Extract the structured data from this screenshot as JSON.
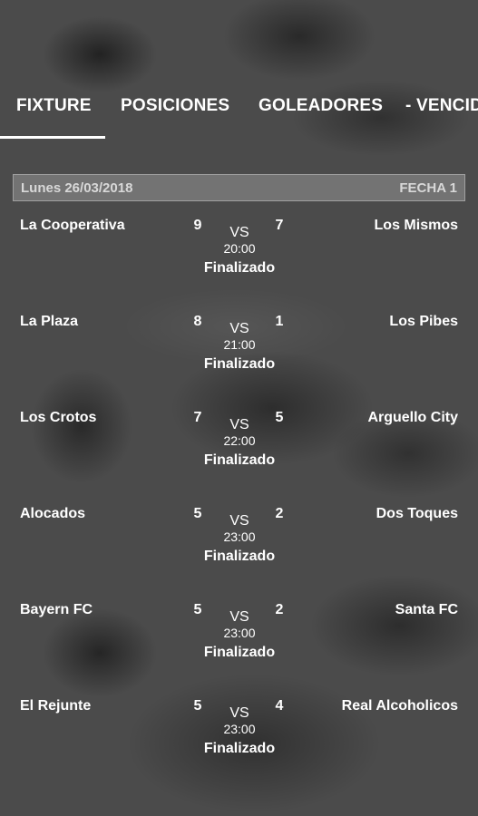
{
  "tabs": [
    {
      "label": "FIXTURE",
      "active": true
    },
    {
      "label": "POSICIONES",
      "active": false
    },
    {
      "label": "GOLEADORES",
      "active": false
    },
    {
      "label": "- VENCID",
      "active": false
    }
  ],
  "round": {
    "date": "Lunes 26/03/2018",
    "fecha": "FECHA 1"
  },
  "matches": [
    {
      "home": "La Cooperativa",
      "home_score": "9",
      "vs": "VS",
      "away_score": "7",
      "away": "Los Mismos",
      "time": "20:00",
      "status": "Finalizado"
    },
    {
      "home": "La Plaza",
      "home_score": "8",
      "vs": "VS",
      "away_score": "1",
      "away": "Los Pibes",
      "time": "21:00",
      "status": "Finalizado"
    },
    {
      "home": "Los Crotos",
      "home_score": "7",
      "vs": "VS",
      "away_score": "5",
      "away": "Arguello City",
      "time": "22:00",
      "status": "Finalizado"
    },
    {
      "home": "Alocados",
      "home_score": "5",
      "vs": "VS",
      "away_score": "2",
      "away": "Dos Toques",
      "time": "23:00",
      "status": "Finalizado"
    },
    {
      "home": "Bayern FC",
      "home_score": "5",
      "vs": "VS",
      "away_score": "2",
      "away": "Santa FC",
      "time": "23:00",
      "status": "Finalizado"
    },
    {
      "home": "El Rejunte",
      "home_score": "5",
      "vs": "VS",
      "away_score": "4",
      "away": "Real Alcoholicos",
      "time": "23:00",
      "status": "Finalizado"
    }
  ]
}
